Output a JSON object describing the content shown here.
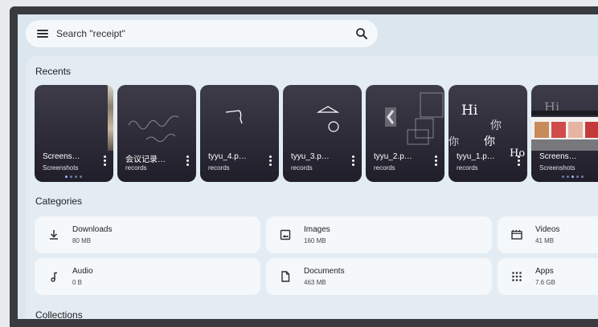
{
  "search": {
    "placeholder": "Search \"receipt\"",
    "menu_icon": "menu-icon",
    "search_icon": "search-icon"
  },
  "recents": {
    "title": "Recents",
    "cards": [
      {
        "name": "Screens…",
        "sub": "Screenshots",
        "thumb": "screenshot-thumbnail"
      },
      {
        "name": "会议记录…",
        "sub": "records",
        "thumb": "squiggle-drawing-thumbnail"
      },
      {
        "name": "tyyu_4.p…",
        "sub": "records",
        "thumb": "stroke-drawing-thumbnail"
      },
      {
        "name": "tyyu_3.p…",
        "sub": "records",
        "thumb": "shapes-drawing-thumbnail"
      },
      {
        "name": "tyyu_2.p…",
        "sub": "records",
        "thumb": "boxes-drawing-thumbnail"
      },
      {
        "name": "tyyu_1.p…",
        "sub": "records",
        "thumb": "handwriting-thumbnail",
        "handwriting": [
          "Hi",
          "你",
          "你",
          "你",
          "Ho"
        ]
      },
      {
        "name": "Screens…",
        "sub": "Screenshots",
        "thumb": "shopping-screenshot-thumbnail",
        "overlay_text": "Hi"
      }
    ]
  },
  "categories": {
    "title": "Categories",
    "items": [
      {
        "label": "Downloads",
        "size": "80 MB",
        "icon": "download-icon"
      },
      {
        "label": "Images",
        "size": "160 MB",
        "icon": "image-icon"
      },
      {
        "label": "Videos",
        "size": "41 MB",
        "icon": "video-icon"
      },
      {
        "label": "Audio",
        "size": "0 B",
        "icon": "music-note-icon"
      },
      {
        "label": "Documents",
        "size": "463 MB",
        "icon": "document-icon"
      },
      {
        "label": "Apps",
        "size": "7.6 GB",
        "icon": "apps-grid-icon"
      }
    ]
  },
  "collections": {
    "title": "Collections"
  }
}
